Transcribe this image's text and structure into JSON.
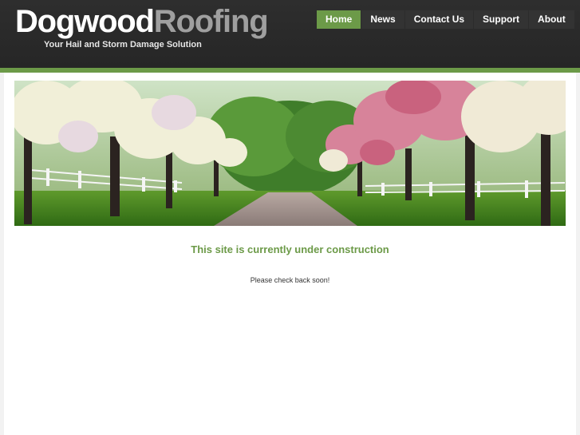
{
  "header": {
    "logo_part1": "Dogwood",
    "logo_part2": "Roofing",
    "tagline": "Your Hail and Storm Damage Solution"
  },
  "nav": {
    "items": [
      {
        "label": "Home",
        "active": true
      },
      {
        "label": "News",
        "active": false
      },
      {
        "label": "Contact Us",
        "active": false
      },
      {
        "label": "Support",
        "active": false
      },
      {
        "label": "About",
        "active": false
      }
    ]
  },
  "main": {
    "heading": "This site is currently under construction",
    "message": "Please check back soon!"
  },
  "colors": {
    "header_bg": "#2a2a2a",
    "accent_green": "#6c9a48",
    "nav_item_bg": "#333333",
    "logo_secondary": "#9f9f9f"
  },
  "banner": {
    "icon": "dogwood-tree-lane-photo"
  }
}
